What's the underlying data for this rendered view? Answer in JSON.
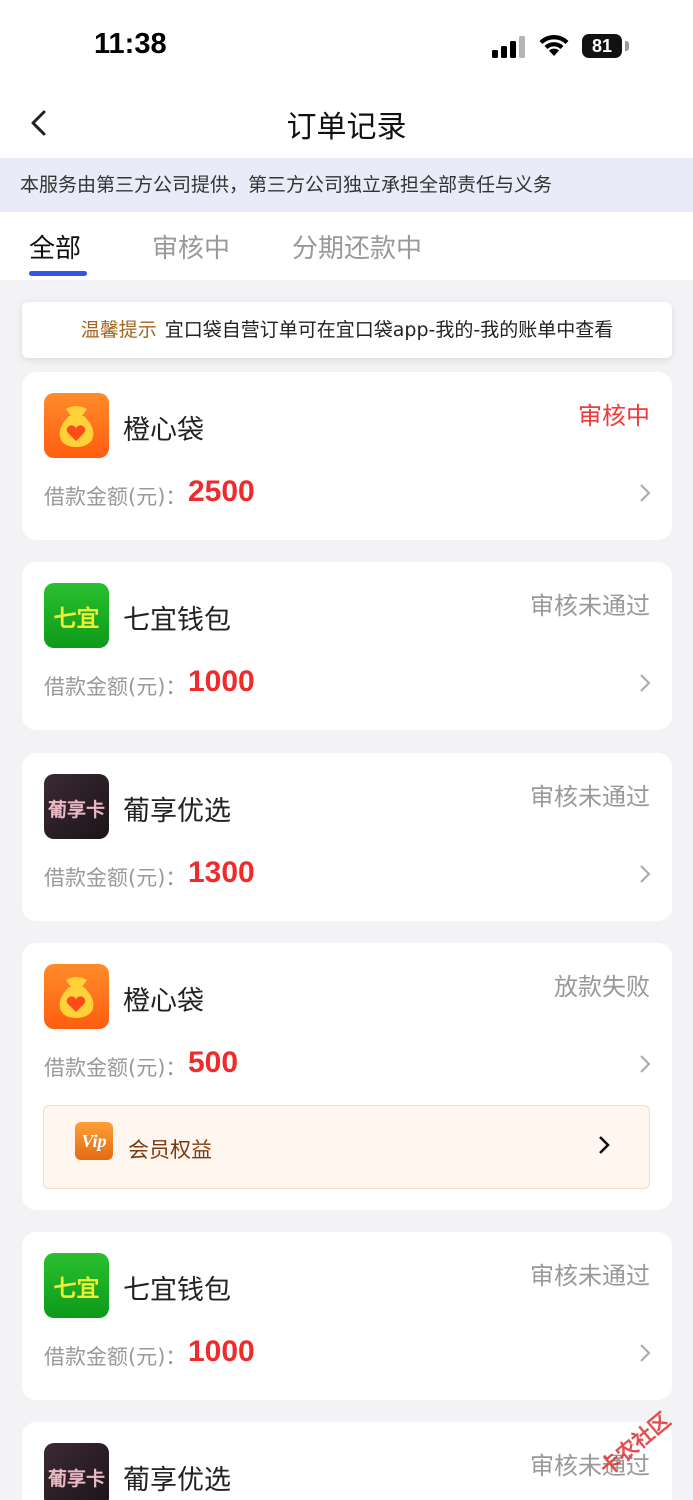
{
  "status_bar": {
    "time": "11:38",
    "battery": "81"
  },
  "nav": {
    "title": "订单记录"
  },
  "notice": "本服务由第三方公司提供，第三方公司独立承担全部责任与义务",
  "tabs": [
    {
      "label": "全部",
      "active": true
    },
    {
      "label": "审核中",
      "active": false
    },
    {
      "label": "分期还款中",
      "active": false
    }
  ],
  "tip": {
    "label": "温馨提示",
    "text": "宜口袋自营订单可在宜口袋app-我的-我的账单中查看"
  },
  "amount_label": "借款金额(元)：",
  "orders": [
    {
      "name": "橙心袋",
      "status": "审核中",
      "amount": "2500",
      "logo": "orange-money-bag-heart-icon",
      "logo_text": ""
    },
    {
      "name": "七宜钱包",
      "status": "审核未通过",
      "amount": "1000",
      "logo": "qiyi-logo",
      "logo_text": "七宜"
    },
    {
      "name": "葡享优选",
      "status": "审核未通过",
      "amount": "1300",
      "logo": "puxiangka-logo",
      "logo_text": "葡享卡"
    },
    {
      "name": "橙心袋",
      "status": "放款失败",
      "amount": "500",
      "logo": "orange-money-bag-heart-icon",
      "logo_text": ""
    },
    {
      "name": "七宜钱包",
      "status": "审核未通过",
      "amount": "1000",
      "logo": "qiyi-logo",
      "logo_text": "七宜"
    },
    {
      "name": "葡享优选",
      "status": "审核未通过",
      "logo": "puxiangka-logo",
      "logo_text": "葡享卡"
    }
  ],
  "vip": {
    "label": "会员权益",
    "icon_text": "Vip"
  },
  "watermark": "卡农社区",
  "colors": {
    "accent": "#3455e8",
    "amount_red": "#ef2b2b",
    "pending_red": "#f03a3a",
    "notice_bg": "#e9ecf8",
    "tip_label": "#a4651e"
  }
}
